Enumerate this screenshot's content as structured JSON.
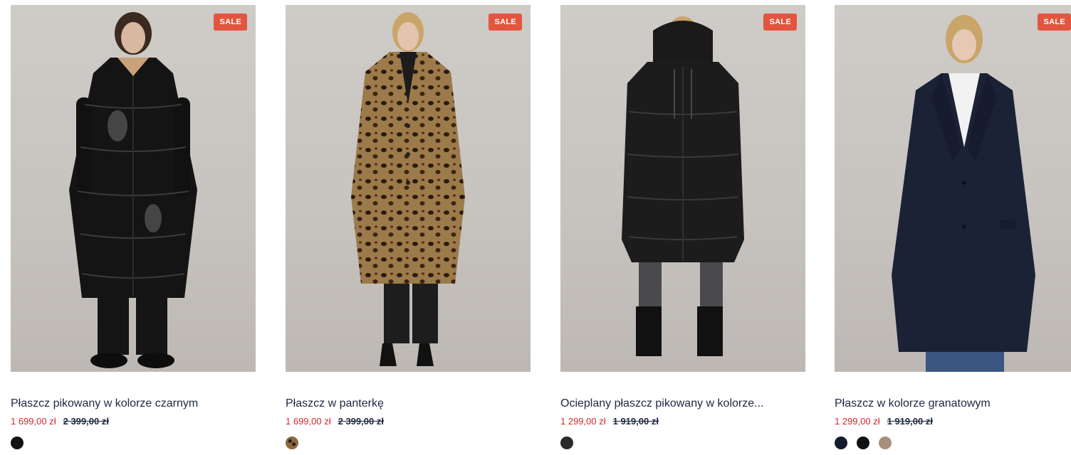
{
  "products": [
    {
      "badge": "SALE",
      "name": "Płaszcz pikowany w kolorze czarnym",
      "price": "1 699,00 zł",
      "old_price": "2 399,00 zł",
      "swatches": [
        {
          "name": "black",
          "color": "#111111"
        }
      ],
      "coat_color": "#141414",
      "coat_style": "puffer-long",
      "image_alt": "model-in-black-quilted-coat"
    },
    {
      "badge": "SALE",
      "name": "Płaszcz w panterkę",
      "price": "1 699,00 zł",
      "old_price": "2 399,00 zł",
      "swatches": [
        {
          "name": "leopard",
          "color": "#6b4f2f"
        }
      ],
      "coat_color": "#8a6a3f",
      "coat_style": "leopard",
      "image_alt": "model-in-leopard-coat"
    },
    {
      "badge": "SALE",
      "name": "Ocieplany płaszcz pikowany w kolorze...",
      "price": "1 299,00 zł",
      "old_price": "1 919,00 zł",
      "swatches": [
        {
          "name": "black",
          "color": "#2a2a2a"
        }
      ],
      "coat_color": "#1c1c1c",
      "coat_style": "puffer-hooded",
      "image_alt": "model-in-insulated-quilted-coat"
    },
    {
      "badge": "SALE",
      "name": "Płaszcz w kolorze granatowym",
      "price": "1 299,00 zł",
      "old_price": "1 919,00 zł",
      "swatches": [
        {
          "name": "navy",
          "color": "#151b2c"
        },
        {
          "name": "black",
          "color": "#111111"
        },
        {
          "name": "beige",
          "color": "#a8907c"
        }
      ],
      "coat_color": "#1b2236",
      "coat_style": "tailored",
      "image_alt": "model-in-navy-coat"
    }
  ],
  "colors": {
    "sale_badge": "#e2553f",
    "sale_price": "#d8262c",
    "text": "#1c2740"
  }
}
